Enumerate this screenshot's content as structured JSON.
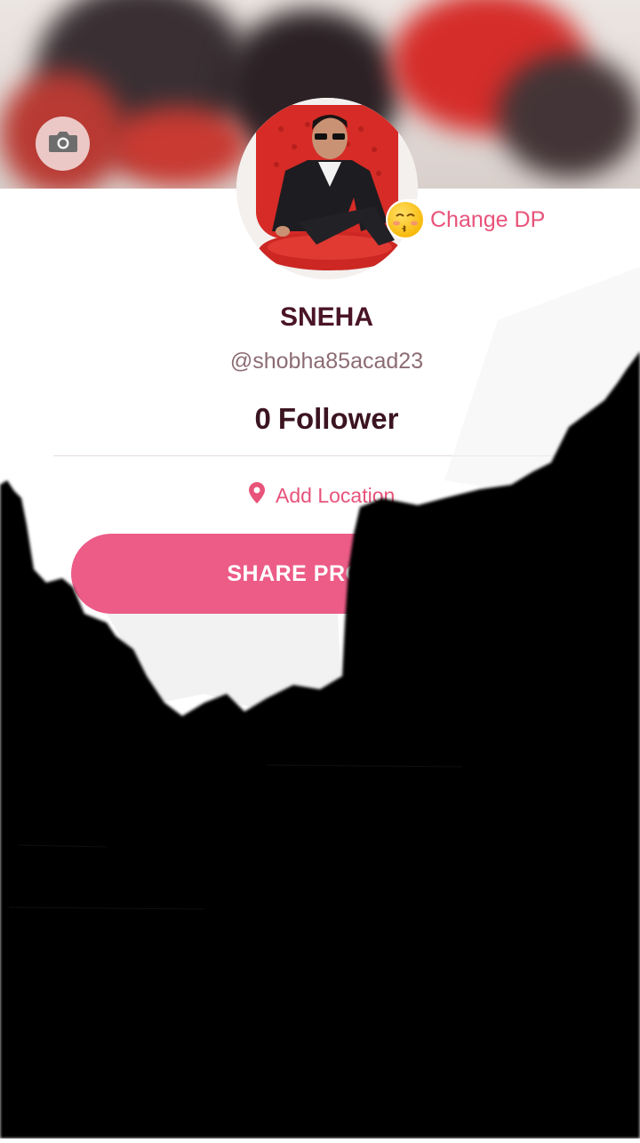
{
  "profile": {
    "name": "SNEHA",
    "handle": "@shobha85acad23",
    "follower_count": "0",
    "follower_label": "Follower"
  },
  "actions": {
    "change_dp_label": "Change DP",
    "location_label": "Add Location",
    "share_label": "SHARE PROFILE"
  },
  "icons": {
    "cover_camera": "camera-icon",
    "change_dp": "kissing-face-emoji-icon",
    "location": "map-pin-icon"
  },
  "colors": {
    "accent": "#e8537a",
    "button": "#ec5c87",
    "name_text": "#4a1526"
  }
}
